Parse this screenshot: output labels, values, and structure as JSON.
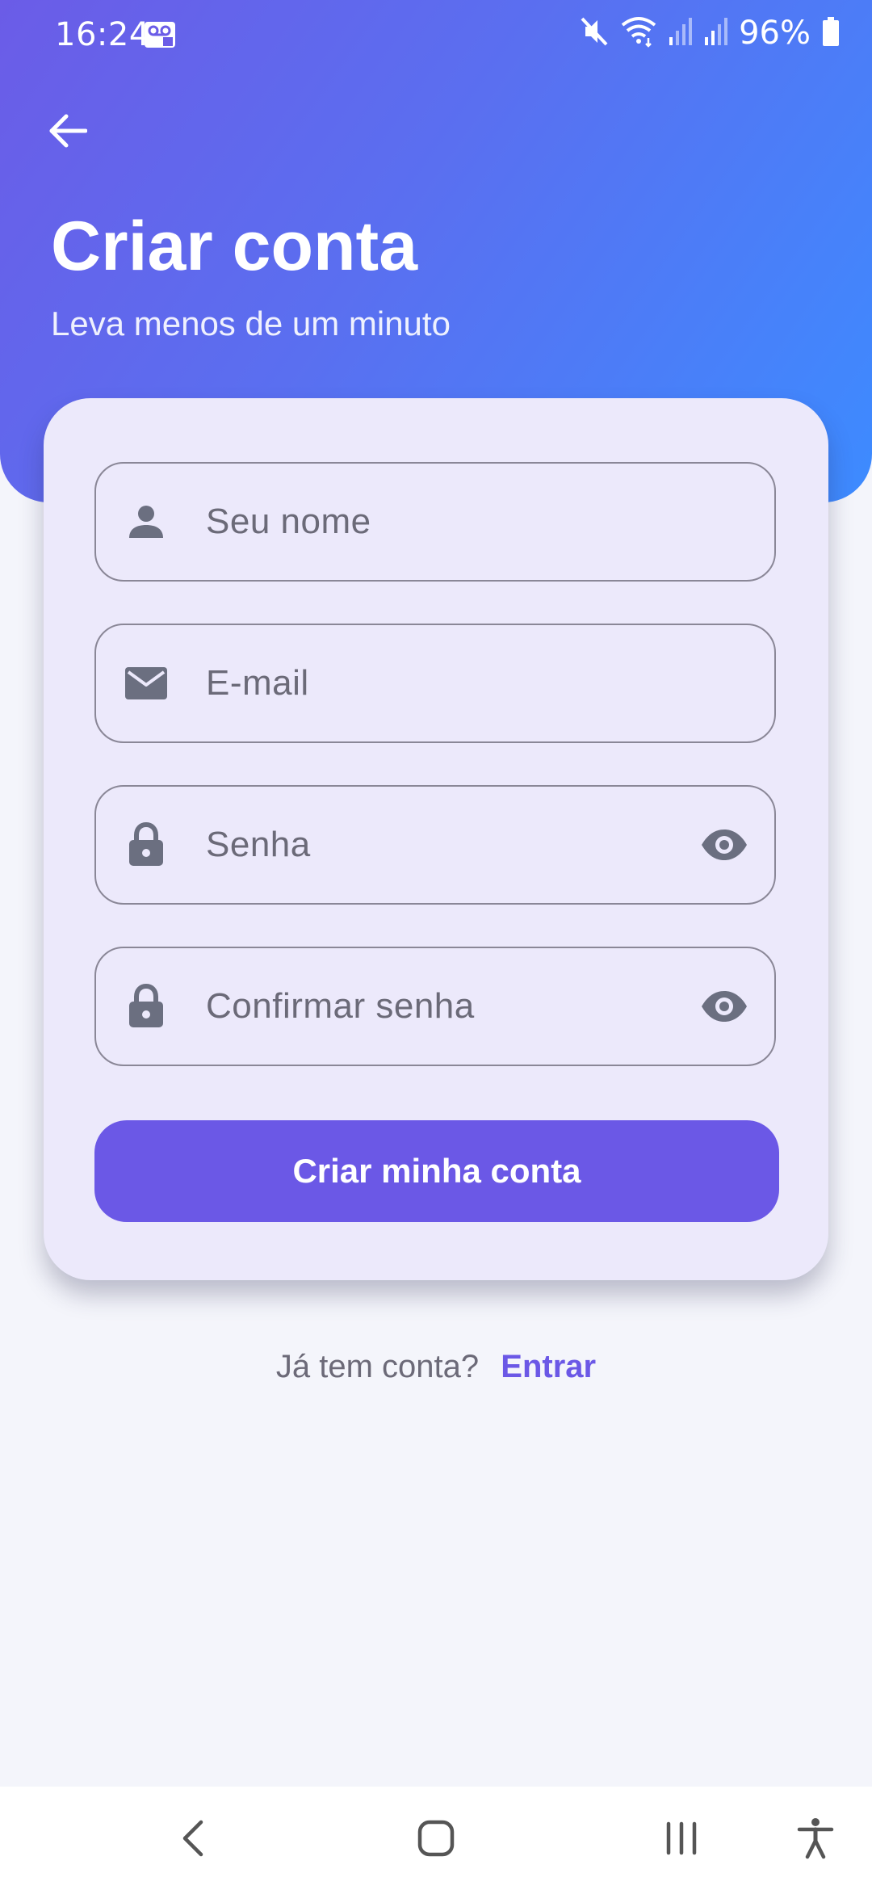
{
  "status_bar": {
    "time": "16:24",
    "battery": "96%"
  },
  "header": {
    "title": "Criar conta",
    "subtitle": "Leva menos de um minuto"
  },
  "form": {
    "name_placeholder": "Seu nome",
    "email_placeholder": "E-mail",
    "password_placeholder": "Senha",
    "confirm_password_placeholder": "Confirmar senha",
    "submit_label": "Criar minha conta"
  },
  "footer": {
    "question": "Já tem conta?",
    "login_link": "Entrar"
  },
  "colors": {
    "accent": "#6b58e6",
    "gradient_start": "#6b5ce7",
    "gradient_end": "#3d8bff",
    "card_bg": "#ece9fb",
    "icon_gray": "#6b6f80"
  }
}
